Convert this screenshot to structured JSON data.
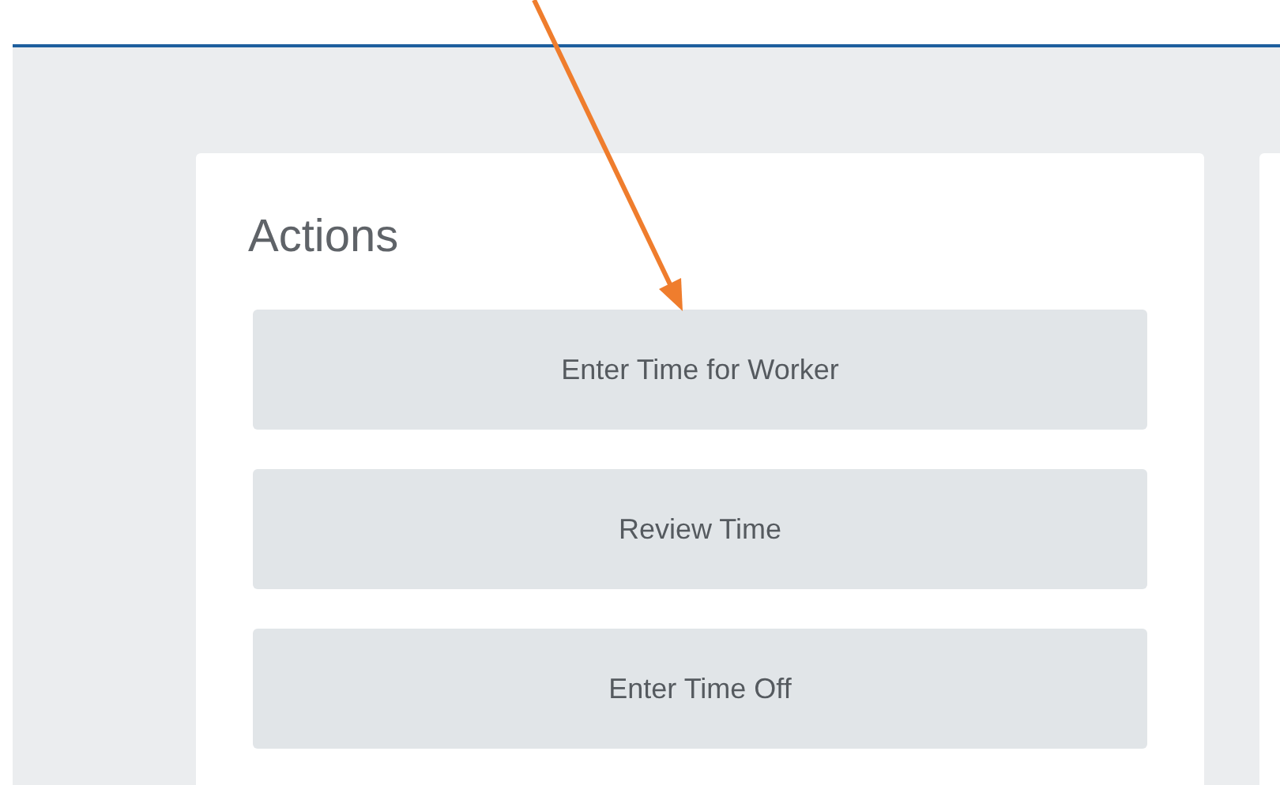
{
  "actions_card": {
    "title": "Actions",
    "buttons": [
      {
        "label": "Enter Time for Worker"
      },
      {
        "label": "Review Time"
      },
      {
        "label": "Enter Time Off"
      }
    ]
  }
}
